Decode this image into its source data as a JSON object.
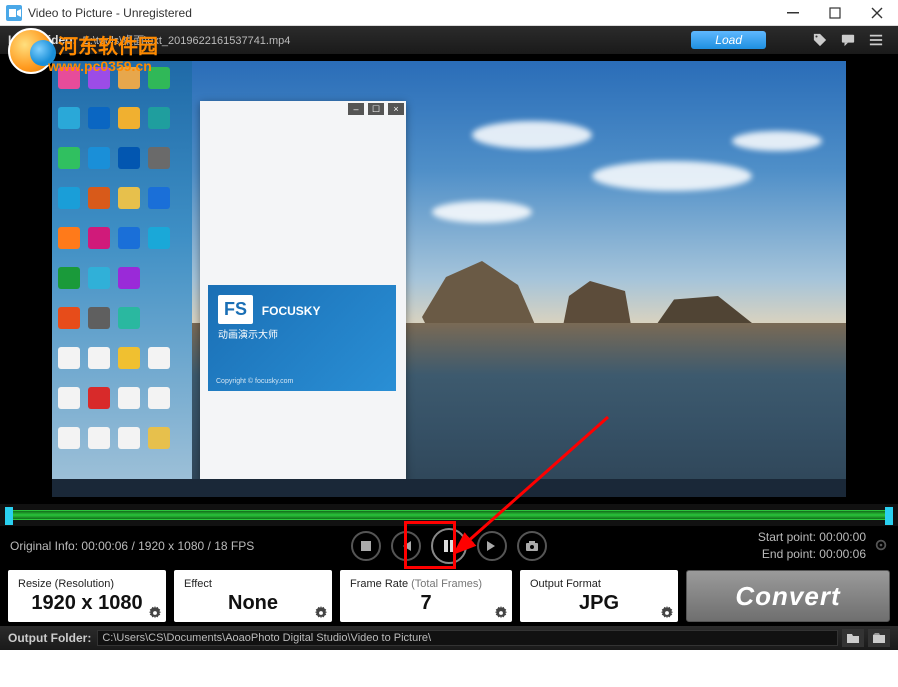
{
  "window": {
    "title": "Video to Picture - Unregistered"
  },
  "watermark": {
    "site_cn": "河东软件园",
    "site_url": "www.pc0359.cn"
  },
  "toolbar": {
    "load_video_label": "Load Video:",
    "video_path": "E:\\tools\\桌面\\ext_2019622161537741.mp4",
    "load_button": "Load"
  },
  "video_preview": {
    "popup_brand_short": "FS",
    "popup_brand_name": "FOCUSKY",
    "popup_brand_sub": "动画演示大师"
  },
  "controls": {
    "original_info_label": "Original Info:",
    "elapsed": "00:00:06",
    "resolution": "1920 x 1080",
    "fps": "18 FPS",
    "start_point_label": "Start point:",
    "start_point": "00:00:00",
    "end_point_label": "End point:",
    "end_point": "00:00:06"
  },
  "cards": {
    "resize": {
      "title": "Resize (Resolution)",
      "value": "1920 x 1080"
    },
    "effect": {
      "title": "Effect",
      "value": "None"
    },
    "framerate": {
      "title_main": "Frame Rate ",
      "title_sub": "(Total Frames)",
      "value": "7"
    },
    "format": {
      "title": "Output Format",
      "value": "JPG"
    },
    "convert_label": "Convert"
  },
  "output": {
    "label": "Output Folder:",
    "path": "C:\\Users\\CS\\Documents\\AoaoPhoto Digital Studio\\Video to Picture\\"
  }
}
